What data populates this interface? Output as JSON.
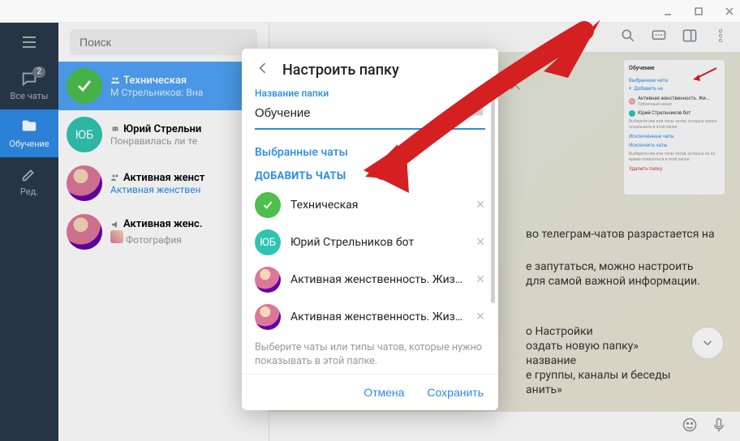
{
  "window": {
    "min": "—",
    "max": "☐",
    "close": "✕"
  },
  "sidebar": {
    "items": [
      {
        "label": "Все чаты",
        "badge": "2"
      },
      {
        "label": "Обучение"
      },
      {
        "label": "Ред."
      }
    ]
  },
  "search": {
    "placeholder": "Поиск"
  },
  "chats": [
    {
      "avatar_type": "green-check",
      "title": "Техническая",
      "icon": "group",
      "sub": "М Стрельников: Вна",
      "selected": true
    },
    {
      "avatar_type": "yb",
      "avatar_text": "ЮБ",
      "title": "Юрий Стрельни",
      "icon": "bot",
      "sub": "Понравилась ли те"
    },
    {
      "avatar_type": "photo",
      "title": "Активная женст",
      "icon": "group",
      "sub": "Активная женствен",
      "sub_link": true
    },
    {
      "avatar_type": "photo",
      "title": "Активная женс.",
      "icon": "channel",
      "sub": "Фотография",
      "has_thumb": true
    }
  ],
  "main": {
    "lines": [
      "во телеграм-чатов разрастается на",
      "е запутаться, можно настроить",
      "для самой важной информации.",
      "о Настройки",
      "оздать новую папку»",
      "название",
      "е группы, каналы и беседы",
      "анить»"
    ]
  },
  "preview": {
    "title_text": "Обучение",
    "selected_label": "Выбранные чаты",
    "add_label": "Добавить ча",
    "row1": "Активная женственность. Жи...",
    "row1_sub": "Публичный канал",
    "row2": "Юрий Стрельников бот",
    "note1": "Выберите нек или типы чатов, которые нужно показывать в этой папке.",
    "exc_label": "Исключённые чаты",
    "exc_add": "Исключить чаты",
    "note2": "Выберите нек или типы чатов, которые не по время появляться в этой папке.",
    "delete": "Удалить папку"
  },
  "modal": {
    "title": "Настроить папку",
    "field_label": "Название папки",
    "field_value": "Обучение",
    "section": "Выбранные чаты",
    "add": "ДОБАВИТЬ ЧАТЫ",
    "options": [
      {
        "avatar": "green-check",
        "name": "Техническая"
      },
      {
        "avatar": "yb",
        "avatar_text": "ЮБ",
        "name": "Юрий Стрельников бот"
      },
      {
        "avatar": "photo",
        "name": "Активная женственность. Жизн..."
      },
      {
        "avatar": "photo",
        "name": "Активная женственность. Жизн..."
      }
    ],
    "hint": "Выберите чаты или типы чатов, которые нужно показывать в этой папке.",
    "cancel": "Отмена",
    "save": "Сохранить"
  },
  "colors": {
    "accent": "#2a8be6"
  }
}
